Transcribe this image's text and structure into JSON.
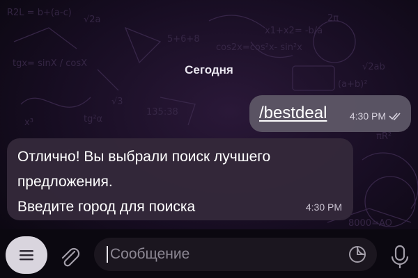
{
  "chat": {
    "date_label": "Сегодня",
    "messages": [
      {
        "direction": "outgoing",
        "text": "/bestdeal",
        "time": "4:30 PM",
        "status": "read-double-check"
      },
      {
        "direction": "incoming",
        "text": "Отлично! Вы выбрали поиск лучшего\nпредложения.\nВведите город для поиска",
        "time": "4:30 PM"
      }
    ]
  },
  "composer": {
    "placeholder": "Сообщение",
    "icons": [
      "menu-icon",
      "paperclip-icon",
      "sticker-icon",
      "microphone-icon"
    ]
  },
  "colors": {
    "background": "#0f0a18",
    "outgoing_bubble": "#5c5665",
    "incoming_bubble": "#34283a",
    "menu_button": "#d9d5de"
  }
}
